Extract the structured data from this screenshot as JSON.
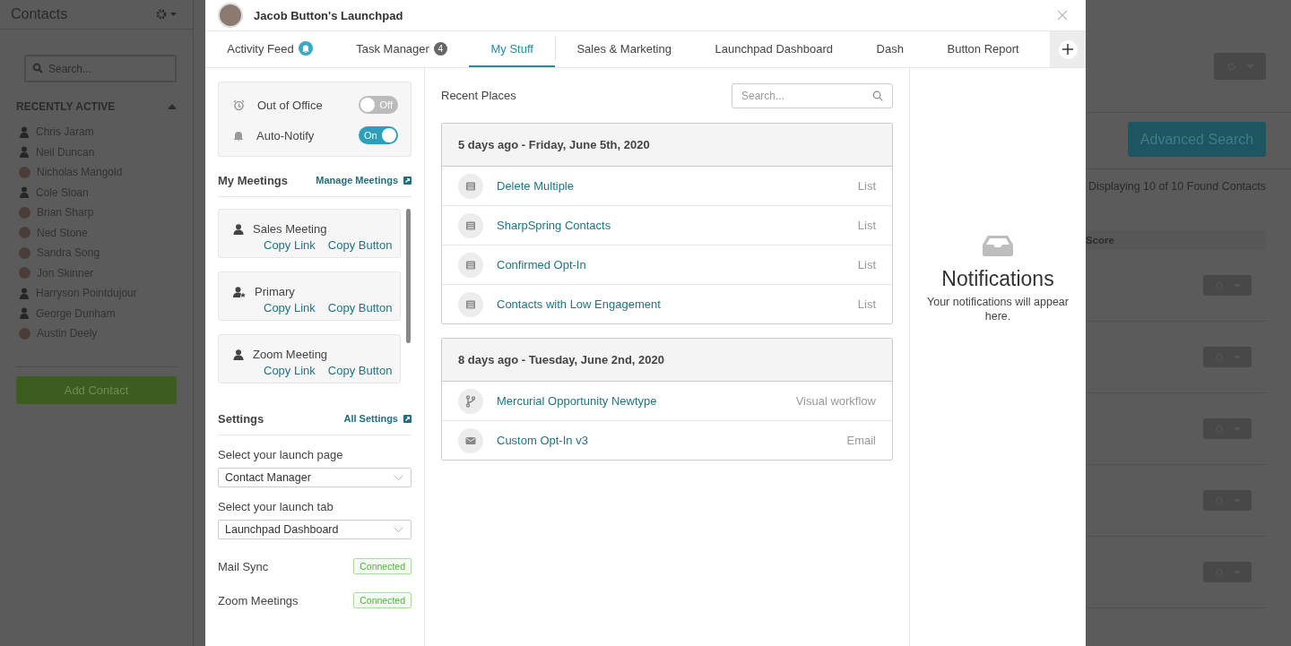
{
  "background": {
    "title": "Contacts",
    "search": {
      "placeholder": "Search..."
    },
    "recent_heading": "RECENTLY ACTIVE",
    "contacts": [
      {
        "name": "Chris Jaram",
        "kind": "silhouette"
      },
      {
        "name": "Neil Duncan",
        "kind": "silhouette"
      },
      {
        "name": "Nicholas Mangold",
        "kind": "photo"
      },
      {
        "name": "Cole Sloan",
        "kind": "silhouette"
      },
      {
        "name": "Brian Sharp",
        "kind": "photo"
      },
      {
        "name": "Ned Stone",
        "kind": "photo"
      },
      {
        "name": "Sandra Song",
        "kind": "photo"
      },
      {
        "name": "Jon Skinner",
        "kind": "photo"
      },
      {
        "name": "Harryson Pointdujour",
        "kind": "silhouette"
      },
      {
        "name": "George Dunham",
        "kind": "silhouette"
      },
      {
        "name": "Austin Deely",
        "kind": "photo"
      }
    ],
    "add_button": "Add Contact",
    "advanced_search": "Advanced Search",
    "display_count": "Displaying 10 of 10 Found Contacts",
    "column_heading": "Score"
  },
  "modal": {
    "title": "Jacob Button's Launchpad",
    "tabs": [
      {
        "label": "Activity Feed",
        "selected": false,
        "alert": true
      },
      {
        "label": "Task Manager",
        "selected": false,
        "count": "4"
      },
      {
        "label": "My Stuff",
        "selected": true
      },
      {
        "label": "Sales & Marketing",
        "selected": false,
        "separator_before": true
      },
      {
        "label": "Launchpad Dashboard",
        "selected": false
      },
      {
        "label": "Dash",
        "selected": false
      },
      {
        "label": "Button Report",
        "selected": false
      }
    ],
    "status": [
      {
        "label": "Out of Office",
        "kind": "alarm",
        "on": false,
        "state": "Off"
      },
      {
        "label": "Auto-Notify",
        "kind": "bell",
        "on": true,
        "state": "On"
      }
    ],
    "meetings": {
      "heading": "My Meetings",
      "link": "Manage Meetings",
      "items": [
        {
          "name": "Sales Meeting",
          "kind": "user",
          "actions": [
            "Copy Link",
            "Copy Button"
          ]
        },
        {
          "name": "Primary",
          "kind": "user-star",
          "actions": [
            "Copy Link",
            "Copy Button"
          ]
        },
        {
          "name": "Zoom Meeting",
          "kind": "user",
          "actions": [
            "Copy Link",
            "Copy Button"
          ]
        }
      ]
    },
    "settings": {
      "heading": "Settings",
      "link": "All Settings",
      "selects": [
        {
          "label": "Select your launch page",
          "value": "Contact Manager"
        },
        {
          "label": "Select your launch tab",
          "value": "Launchpad Dashboard"
        }
      ],
      "integrations": [
        {
          "name": "Mail Sync",
          "status": "Connected"
        },
        {
          "name": "Zoom Meetings",
          "status": "Connected"
        }
      ]
    },
    "recent": {
      "heading": "Recent Places",
      "search": {
        "placeholder": "Search..."
      },
      "groups": [
        {
          "heading": "5 days ago - Friday, June 5th, 2020",
          "items": [
            {
              "name": "Delete Multiple",
              "type": "List",
              "kind": "list"
            },
            {
              "name": "SharpSpring Contacts",
              "type": "List",
              "kind": "list"
            },
            {
              "name": "Confirmed Opt-In",
              "type": "List",
              "kind": "list"
            },
            {
              "name": "Contacts with Low Engagement",
              "type": "List",
              "kind": "list"
            }
          ]
        },
        {
          "heading": "8 days ago - Tuesday, June 2nd, 2020",
          "items": [
            {
              "name": "Mercurial Opportunity Newtype",
              "type": "Visual workflow",
              "kind": "workflow"
            },
            {
              "name": "Custom Opt-In v3",
              "type": "Email",
              "kind": "email"
            }
          ]
        }
      ]
    },
    "notifications": {
      "heading": "Notifications",
      "message": "Your notifications will appear here."
    }
  }
}
